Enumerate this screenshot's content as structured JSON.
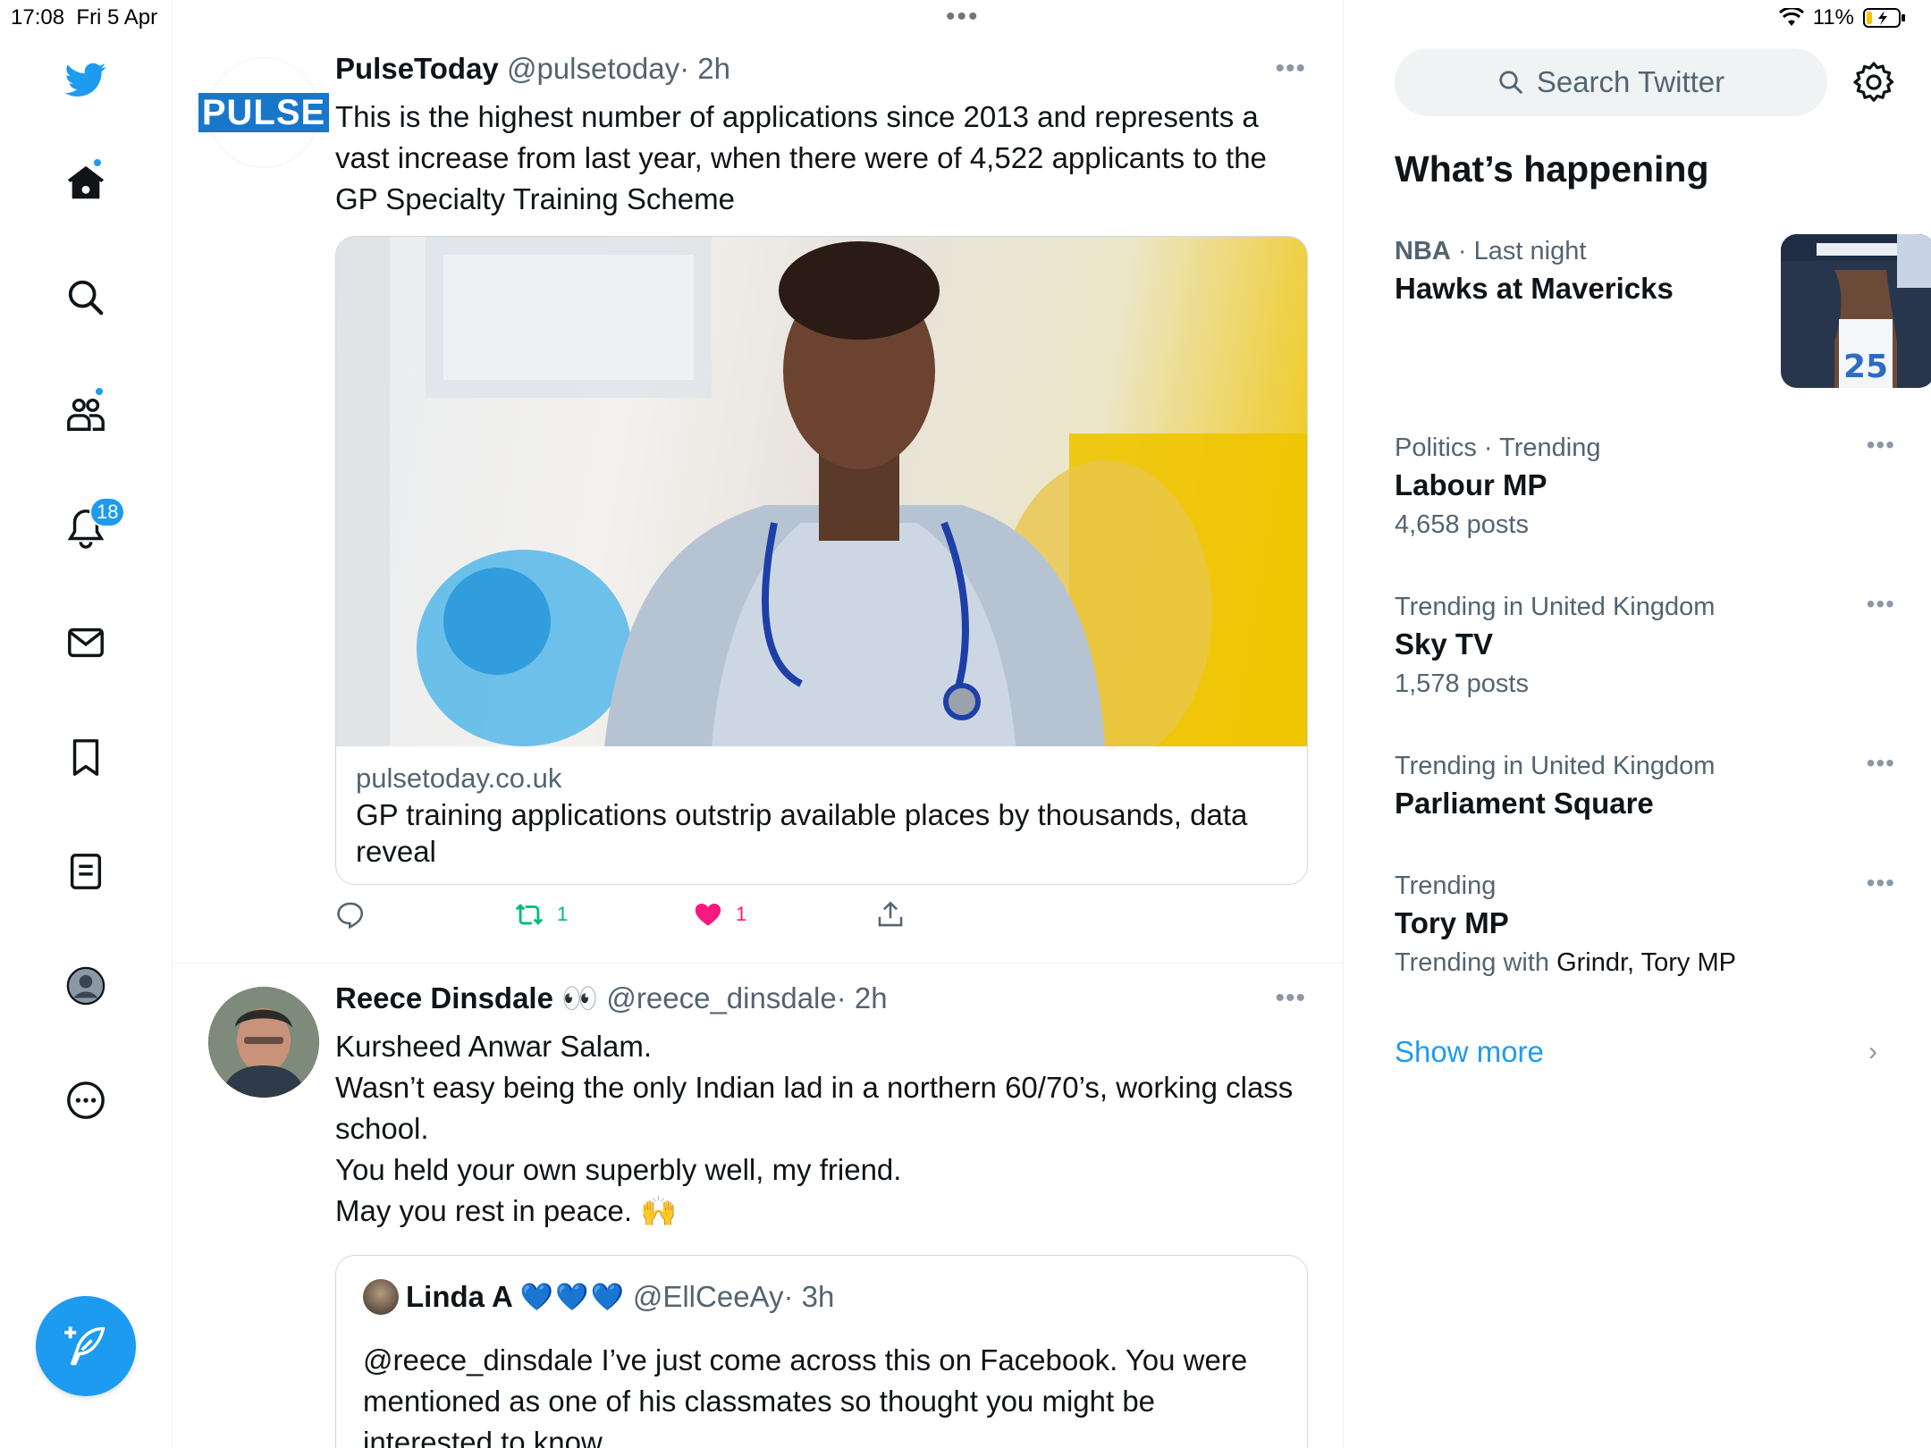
{
  "status_bar": {
    "time": "17:08",
    "date": "Fri 5 Apr",
    "battery": "11%"
  },
  "colors": {
    "accent": "#1d9bf0",
    "retweet": "#00ba7c",
    "like": "#f91880"
  },
  "nav": {
    "items": [
      "twitter-logo",
      "home",
      "explore",
      "communities",
      "notifications",
      "messages",
      "bookmarks",
      "lists",
      "profile",
      "more"
    ],
    "notifications_badge": "18"
  },
  "tweets": [
    {
      "name": "PulseToday",
      "handle": "@pulsetoday",
      "time": "· 2h",
      "avatar_text": "PULSE",
      "text": "This is the highest number of applications since 2013 and represents a vast increase from last year, when there were of 4,522 applicants to the GP Specialty Training Scheme",
      "card": {
        "domain": "pulsetoday.co.uk",
        "title": "GP training applications outstrip available places by thousands, data reveal"
      },
      "actions": {
        "reply": "",
        "retweets": "1",
        "likes": "1"
      }
    },
    {
      "name": "Reece Dinsdale",
      "emoji": "👀",
      "handle": "@reece_dinsdale",
      "time": "· 2h",
      "text_lines": [
        "Kursheed Anwar Salam.",
        "Wasn’t easy being the only Indian lad in a northern 60/70’s, working class school.",
        "You held your own superbly well, my friend.",
        "May you rest in peace. 🙌"
      ],
      "quote": {
        "name": "Linda A",
        "hearts": "💙💙💙",
        "handle": "@EllCeeAy",
        "time": "· 3h",
        "text": "@reece_dinsdale I’ve just come across this on Facebook. You were mentioned as one of his classmates so thought you might be interested to know."
      }
    }
  ],
  "sidebar": {
    "search_placeholder": "Search Twitter",
    "title": "What’s happening",
    "trends": [
      {
        "category": "NBA",
        "context": "· Last night",
        "name": "Hawks at Mavericks",
        "sub": ""
      },
      {
        "category": "Politics · Trending",
        "context": "",
        "name": "Labour MP",
        "sub": "4,658 posts"
      },
      {
        "category": "Trending in United Kingdom",
        "context": "",
        "name": "Sky TV",
        "sub": "1,578 posts"
      },
      {
        "category": "Trending in United Kingdom",
        "context": "",
        "name": "Parliament Square",
        "sub": ""
      },
      {
        "category": "Trending",
        "context": "",
        "name": "Tory MP",
        "sub_prefix": "Trending with",
        "sub_dark": "Grindr, Tory MP"
      }
    ],
    "show_more": "Show more"
  }
}
